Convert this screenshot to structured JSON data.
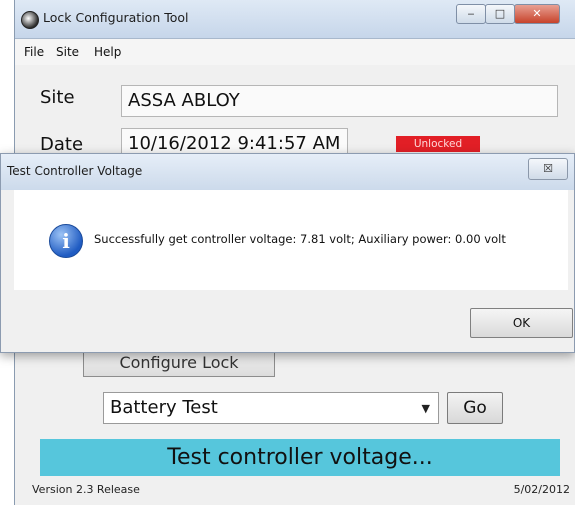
{
  "window": {
    "title": "Lock Configuration Tool",
    "icon": "app-icon",
    "controls": {
      "minimize": "‒",
      "maximize": "□",
      "close": "✕"
    }
  },
  "menu": [
    "File",
    "Site",
    "Help"
  ],
  "form": {
    "site_label": "Site",
    "site_value": "ASSA ABLOY",
    "date_label": "Date",
    "date_value": "10/16/2012 9:41:57 AM",
    "lock_status": "Unlocked"
  },
  "actions": {
    "configure_label": "Configure Lock",
    "test_select_value": "Battery Test",
    "go_label": "Go"
  },
  "progress_text": "Test controller voltage...",
  "footer": {
    "version": "Version 2.3 Release",
    "date": "5/02/2012"
  },
  "dialog": {
    "title": "Test Controller Voltage",
    "close_glyph": "☒",
    "icon": "info-icon",
    "icon_glyph": "i",
    "message": "Successfully get controller voltage: 7.81 volt; Auxiliary power: 0.00 volt",
    "ok_label": "OK"
  },
  "colors": {
    "status_badge": "#e21f26",
    "progress_banner": "#56c6dc"
  }
}
